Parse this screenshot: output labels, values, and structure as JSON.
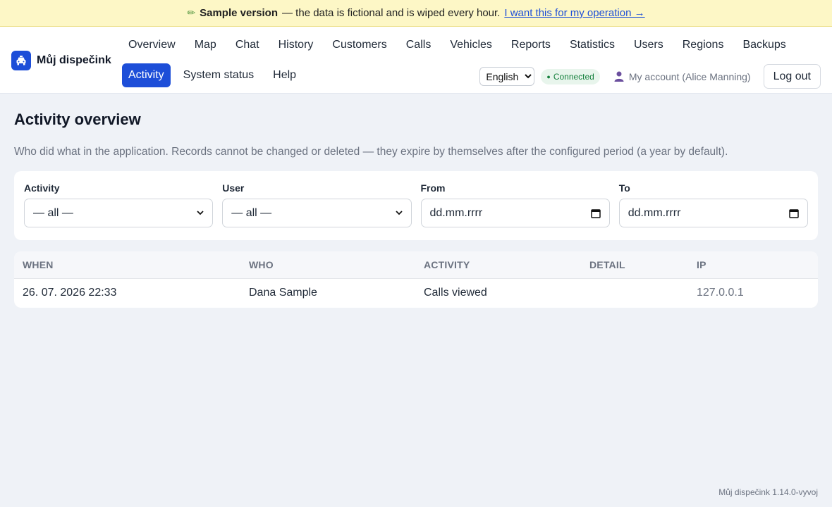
{
  "banner": {
    "title": "Sample version",
    "text": "— the data is fictional and is wiped every hour.",
    "link": "I want this for my operation →"
  },
  "brand": {
    "name": "Můj dispečink",
    "icon": "taxi-icon"
  },
  "nav": {
    "row1": [
      "Overview",
      "Map",
      "Chat",
      "History",
      "Customers",
      "Calls",
      "Vehicles",
      "Reports",
      "Statistics",
      "Users",
      "Regions",
      "Backups"
    ],
    "row2": [
      "Activity",
      "System status",
      "Help"
    ],
    "active": "Activity"
  },
  "header": {
    "language": "English",
    "status": "Connected",
    "account": "My account (Alice Manning)",
    "logout": "Log out"
  },
  "page": {
    "title": "Activity overview",
    "description": "Who did what in the application. Records cannot be changed or deleted — they expire by themselves after the configured period (a year by default)."
  },
  "filters": {
    "activity": {
      "label": "Activity",
      "value": "— all —"
    },
    "user": {
      "label": "User",
      "value": "— all —"
    },
    "from": {
      "label": "From",
      "placeholder": "dd.mm.rrrr"
    },
    "to": {
      "label": "To",
      "placeholder": "dd.mm.rrrr"
    }
  },
  "table": {
    "columns": [
      "WHEN",
      "WHO",
      "ACTIVITY",
      "DETAIL",
      "IP"
    ],
    "rows": [
      [
        "26. 07. 2026 22:33",
        "Dana Sample",
        "Calls viewed",
        "",
        "127.0.0.1"
      ]
    ]
  },
  "footer": {
    "version": "Můj dispečink 1.14.0-vyvoj"
  },
  "colors": {
    "accent": "#1d4ed8",
    "banner_bg": "#fdf7c6",
    "connected": "#15803d"
  }
}
